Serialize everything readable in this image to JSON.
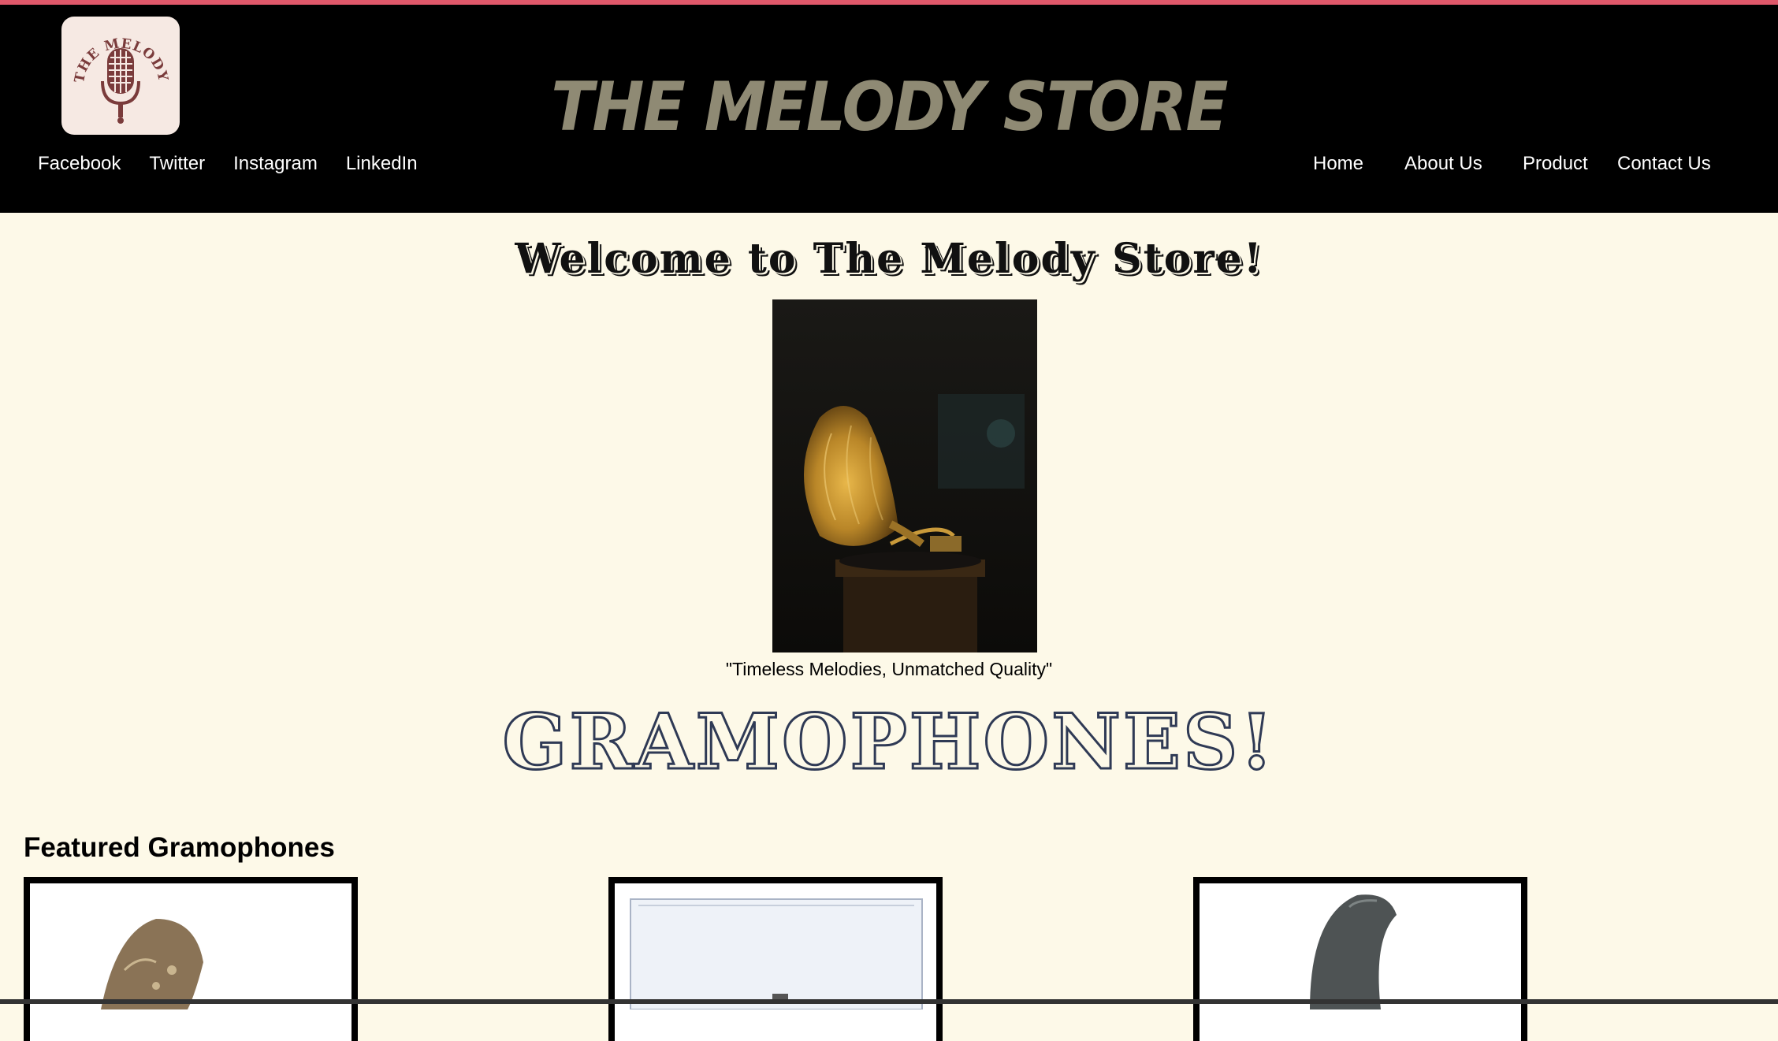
{
  "header": {
    "site_title": "THE MELODY STORE",
    "logo_text": "THE MELODY STORE"
  },
  "social": [
    "Facebook",
    "Twitter",
    "Instagram",
    "LinkedIn"
  ],
  "nav": [
    "Home",
    "About Us",
    "Product",
    "Contact Us"
  ],
  "main": {
    "welcome": "Welcome to The Melody Store!",
    "caption": "\"Timeless Melodies, Unmatched Quality\"",
    "section_title": "GRAMOPHONES!",
    "featured_heading": "Featured Gramophones"
  },
  "colors": {
    "accent_line": "#e0586a",
    "header_bg": "#000000",
    "title_color": "#8f8a74",
    "page_bg": "#fdf9e8",
    "outline_text": "#2f3a55"
  },
  "icons": [
    "microphone-logo-icon"
  ]
}
